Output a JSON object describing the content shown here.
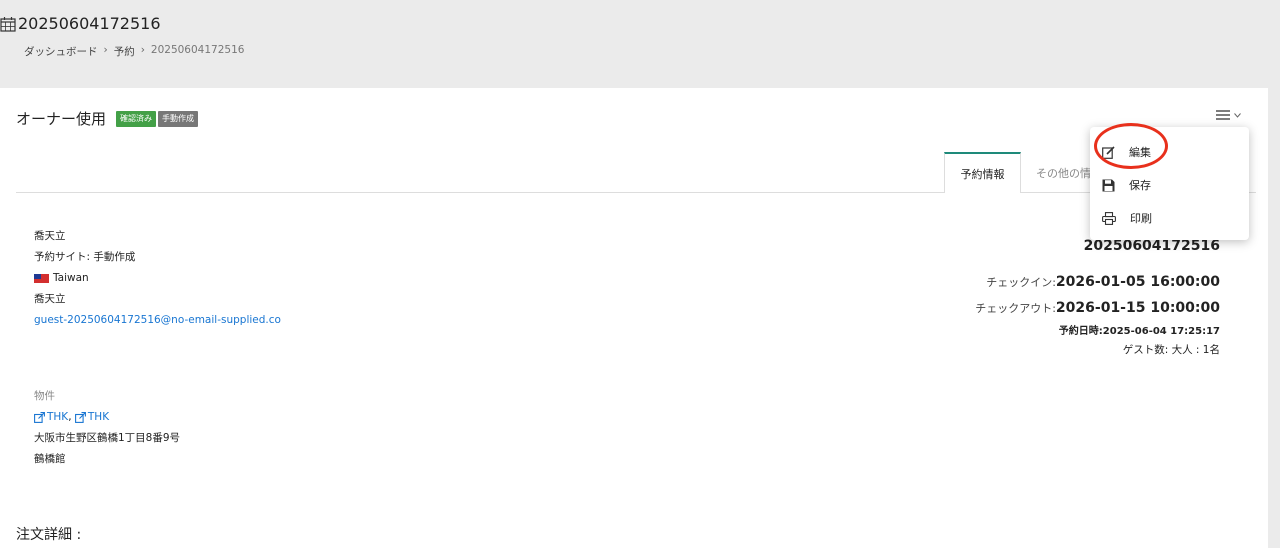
{
  "header": {
    "title": "20250604172516",
    "calendar_icon": "calendar-icon",
    "breadcrumb": {
      "home": "ダッシュボード",
      "section": "予約",
      "current": "20250604172516",
      "separator": "›"
    }
  },
  "card": {
    "title": "オーナー使用",
    "badges": {
      "confirmed": "確認済み",
      "manual": "手動作成"
    },
    "menu_icon": "hamburger-icon"
  },
  "tabs": {
    "active": "予約情報",
    "other": "その他の情"
  },
  "dropdown": {
    "edit": "編集",
    "save": "保存",
    "print": "印刷"
  },
  "guest": {
    "name": "喬天立",
    "site": "予約サイト: 手動作成",
    "country": "Taiwan",
    "name2": "喬天立",
    "email": "guest-20250604172516@no-email-supplied.co"
  },
  "property": {
    "label": "物件",
    "link1": "THK",
    "link2": "THK",
    "address": "大阪市生野区鶴橋1丁目8番9号",
    "building": "鶴橋館"
  },
  "reservation": {
    "id": "20250604172516",
    "checkin_label": "チェックイン:",
    "checkin": "2026-01-05 16:00:00",
    "checkout_label": "チェックアウト:",
    "checkout": "2026-01-15 10:00:00",
    "booked_label": "予約日時:",
    "booked": "2025-06-04 17:25:17",
    "guests": "ゲスト数: 大人 : 1名"
  },
  "order_detail": "注文詳細 :",
  "colors": {
    "badge_green": "#43a047",
    "badge_gray": "#777777",
    "tab_accent": "#1e8a7a",
    "link": "#1976d2",
    "highlight": "#e8301c"
  }
}
